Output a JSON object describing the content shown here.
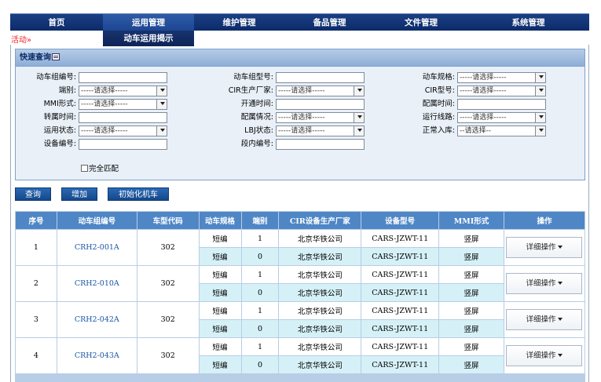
{
  "nav": {
    "items": [
      "首页",
      "运用管理",
      "维护管理",
      "备品管理",
      "文件管理",
      "系统管理"
    ],
    "sub_item": "动车运用揭示"
  },
  "breadcrumb": {
    "text": "活动",
    "sep": "»"
  },
  "query": {
    "title": "快速查询",
    "fields": {
      "emu_no": {
        "label": "动车组编号:",
        "value": ""
      },
      "emu_model": {
        "label": "动车组型号:",
        "value": ""
      },
      "emu_spec": {
        "label": "动车规格:",
        "value": "-----请选择-----"
      },
      "end": {
        "label": "端别:",
        "value": "-----请选择-----"
      },
      "cir_vendor": {
        "label": "CIR生产厂家:",
        "value": "-----请选择-----"
      },
      "cir_model": {
        "label": "CIR型号:",
        "value": "-----请选择-----"
      },
      "mmi": {
        "label": "MMI形式:",
        "value": "-----请选择-----"
      },
      "open_time": {
        "label": "开通时间:",
        "value": ""
      },
      "config_time": {
        "label": "配属时间:",
        "value": ""
      },
      "transfer_time": {
        "label": "转属时间:",
        "value": ""
      },
      "config_status": {
        "label": "配属情况:",
        "value": "-----请选择-----"
      },
      "route": {
        "label": "运行线路:",
        "value": "-----请选择-----"
      },
      "run_status": {
        "label": "运用状态:",
        "value": "-----请选择-----"
      },
      "lbj_status": {
        "label": "LBJ状态:",
        "value": "-----请选择-----"
      },
      "normal_in": {
        "label": "正常入库:",
        "value": "--请选择--"
      },
      "device_no": {
        "label": "设备编号:",
        "value": ""
      },
      "section_no": {
        "label": "段内编号:",
        "value": ""
      }
    },
    "exact_match": "完全匹配"
  },
  "toolbar": {
    "search": "查询",
    "add": "增加",
    "init": "初始化机车"
  },
  "table": {
    "headers": [
      "序号",
      "动车组编号",
      "车型代码",
      "动车规格",
      "端别",
      "CIR设备生产厂家",
      "设备型号",
      "MMI形式",
      "操作"
    ],
    "rows": [
      {
        "no": "1",
        "emu": "CRH2-001A",
        "code": "302",
        "sub": [
          {
            "spec": "短编",
            "end": "1",
            "vendor": "北京华铁公司",
            "model": "CARS-JZWT-11",
            "mmi": "竖屏"
          },
          {
            "spec": "短编",
            "end": "0",
            "vendor": "北京华铁公司",
            "model": "CARS-JZWT-11",
            "mmi": "竖屏"
          }
        ],
        "op": "详细操作"
      },
      {
        "no": "2",
        "emu": "CRH2-010A",
        "code": "302",
        "sub": [
          {
            "spec": "短编",
            "end": "1",
            "vendor": "北京华铁公司",
            "model": "CARS-JZWT-11",
            "mmi": "竖屏"
          },
          {
            "spec": "短编",
            "end": "0",
            "vendor": "北京华铁公司",
            "model": "CARS-JZWT-11",
            "mmi": "竖屏"
          }
        ],
        "op": "详细操作"
      },
      {
        "no": "3",
        "emu": "CRH2-042A",
        "code": "302",
        "sub": [
          {
            "spec": "短编",
            "end": "1",
            "vendor": "北京华铁公司",
            "model": "CARS-JZWT-11",
            "mmi": "竖屏"
          },
          {
            "spec": "短编",
            "end": "0",
            "vendor": "北京华铁公司",
            "model": "CARS-JZWT-11",
            "mmi": "竖屏"
          }
        ],
        "op": "详细操作"
      },
      {
        "no": "4",
        "emu": "CRH2-043A",
        "code": "302",
        "sub": [
          {
            "spec": "短编",
            "end": "1",
            "vendor": "北京华铁公司",
            "model": "CARS-JZWT-11",
            "mmi": "竖屏"
          },
          {
            "spec": "短编",
            "end": "0",
            "vendor": "北京华铁公司",
            "model": "CARS-JZWT-11",
            "mmi": "竖屏"
          }
        ],
        "op": "详细操作"
      }
    ]
  },
  "colors": {
    "nav": "#1b3f84",
    "header": "#4f86c6",
    "alt_row": "#d5f1f7",
    "link": "#1a56a5",
    "breadcrumb": "#ee2222"
  }
}
